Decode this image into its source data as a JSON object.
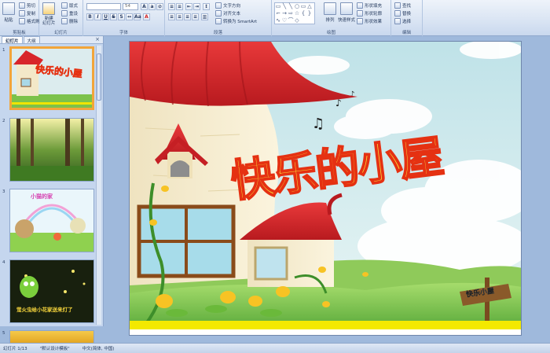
{
  "ribbon": {
    "groups": [
      {
        "label": "剪贴板"
      },
      {
        "label": "幻灯片"
      },
      {
        "label": "字体"
      },
      {
        "label": "段落"
      },
      {
        "label": "绘图"
      },
      {
        "label": "编辑"
      }
    ],
    "clipboard": {
      "paste": "粘贴",
      "cut": "剪切",
      "copy": "复制",
      "format_painter": "格式刷"
    },
    "slides": {
      "new_slide": "新建\n幻灯片",
      "layout": "版式",
      "reset": "重设",
      "delete": "删除"
    },
    "font": {
      "font_name": "",
      "font_size": "54"
    },
    "paragraph": {
      "text_direction": "文字方向",
      "align_text": "对齐文本",
      "smartart": "转换为 SmartArt"
    },
    "drawing": {
      "arrange": "排列",
      "quick_styles": "快速样式",
      "fill": "形状填充",
      "outline": "形状轮廓",
      "effects": "形状效果"
    },
    "editing": {
      "find": "查找",
      "replace": "替换",
      "select": "选择"
    }
  },
  "panel": {
    "tabs": [
      "幻灯片",
      "大纲"
    ],
    "close": "×",
    "slides": [
      {
        "num": "1",
        "title": "快乐的小屋"
      },
      {
        "num": "2"
      },
      {
        "num": "3",
        "title": "小猫的家"
      },
      {
        "num": "4",
        "caption": "萤火虫给小花家送来灯了"
      },
      {
        "num": "5"
      }
    ]
  },
  "slide": {
    "title": "快乐的小屋",
    "sign": "快乐小屋"
  },
  "status": {
    "slide_count": "幻灯片 1/13",
    "theme": "\"默认设计模板\"",
    "language": "中文(简体, 中国)"
  },
  "colors": {
    "title_fill": "#f7e23a",
    "title_stroke": "#e53112",
    "roof": "#d8252a",
    "sky": "#d4ebee",
    "grass": "#5fb43b",
    "selected": "#f2a53a"
  }
}
